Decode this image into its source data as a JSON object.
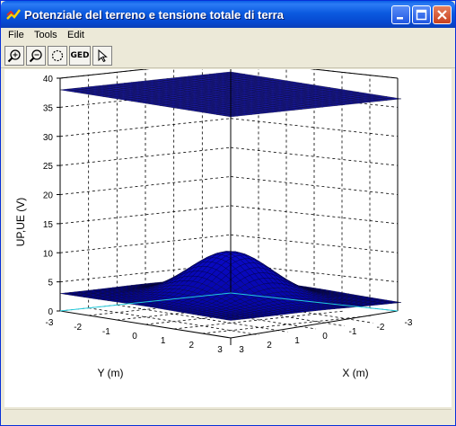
{
  "window": {
    "title": "Potenziale del terreno e tensione totale di terra",
    "icon": "scilab-icon",
    "controls": [
      "minimize-icon",
      "maximize-icon",
      "close-icon"
    ]
  },
  "menu": {
    "items": [
      "File",
      "Tools",
      "Edit"
    ]
  },
  "toolbar": {
    "buttons": [
      {
        "name": "zoom-in",
        "icon": "zoom-in-icon"
      },
      {
        "name": "zoom-out",
        "icon": "zoom-out-icon"
      },
      {
        "name": "rotate",
        "icon": "rotate-icon"
      },
      {
        "name": "ged",
        "label": "GED"
      },
      {
        "name": "pointer",
        "icon": "pointer-icon"
      }
    ]
  },
  "chart_data": {
    "type": "surface3d",
    "zlabel": "UP,UE (V)",
    "xlabel": "X (m)",
    "ylabel": "Y (m)",
    "zlim": [
      0,
      40
    ],
    "xlim": [
      -3,
      3
    ],
    "ylim": [
      -3,
      3
    ],
    "z_ticks": [
      "0",
      "5",
      "10",
      "15",
      "20",
      "25",
      "30",
      "35",
      "40"
    ],
    "y_ticks": [
      "-3",
      "-2",
      "-1",
      "0",
      "1",
      "2",
      "3"
    ],
    "x_ticks": [
      "3",
      "2",
      "1",
      "0",
      "-1",
      "-2",
      "-3"
    ],
    "surfaces": [
      {
        "name": "UE",
        "description": "flat plane",
        "value": 38
      },
      {
        "name": "UP",
        "description": "peak at origin",
        "peak": 11,
        "edge": 3
      }
    ],
    "surface_color": "#1010a0",
    "grid": true
  }
}
